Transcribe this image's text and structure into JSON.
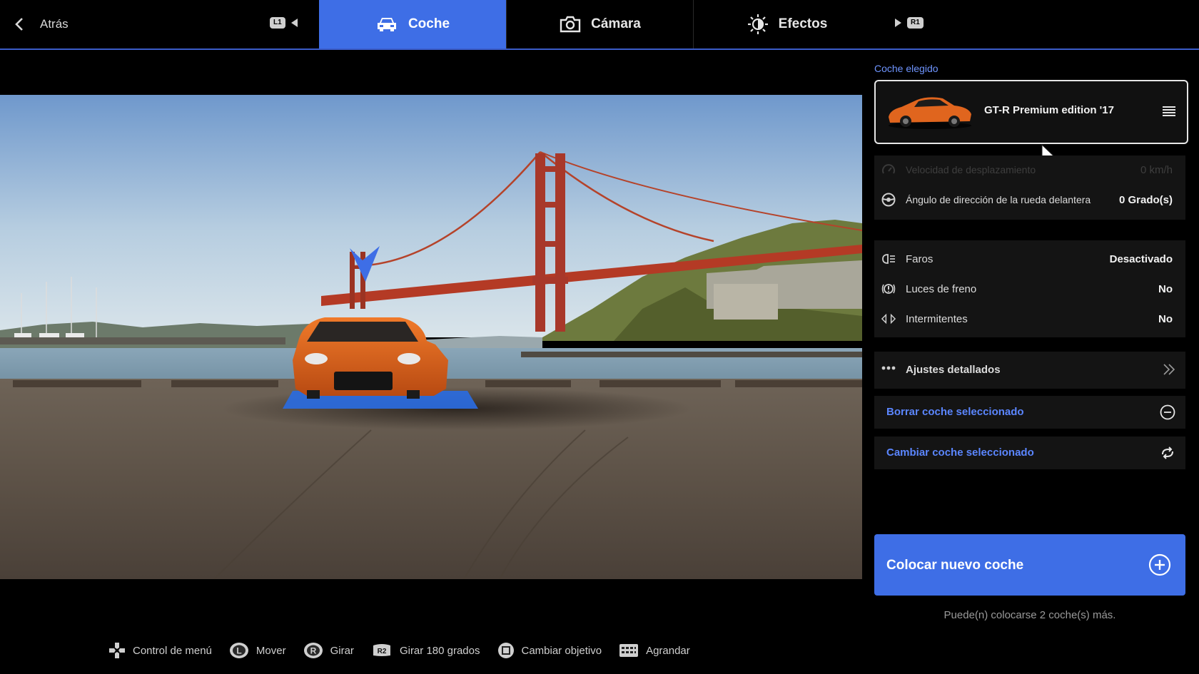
{
  "topbar": {
    "back_label": "Atrás",
    "left_shoulder": "L1",
    "right_shoulder": "R1",
    "tabs": [
      {
        "label": "Coche",
        "icon": "car-icon",
        "active": true
      },
      {
        "label": "Cámara",
        "icon": "camera-icon",
        "active": false
      },
      {
        "label": "Efectos",
        "icon": "brightness-icon",
        "active": false
      }
    ]
  },
  "panel": {
    "section_label": "Coche elegido",
    "selected_car": "GT-R Premium edition '17",
    "settings_group_1": [
      {
        "label": "Velocidad de desplazamiento",
        "value": "0 km/h",
        "icon": "speedometer-icon",
        "disabled": true
      },
      {
        "label": "Ángulo de dirección de la rueda delantera",
        "value": "0 Grado(s)",
        "icon": "steering-wheel-icon",
        "disabled": false
      }
    ],
    "settings_group_2": [
      {
        "label": "Faros",
        "value": "Desactivado",
        "icon": "headlight-icon"
      },
      {
        "label": "Luces de freno",
        "value": "No",
        "icon": "brake-light-icon"
      },
      {
        "label": "Intermitentes",
        "value": "No",
        "icon": "turn-signal-icon"
      }
    ],
    "detailed_settings": "Ajustes detallados",
    "delete_car": "Borrar coche seleccionado",
    "change_car": "Cambiar coche seleccionado",
    "place_new_car": "Colocar nuevo coche",
    "remaining_note": "Puede(n) colocarse 2 coche(s) más."
  },
  "hints": [
    {
      "button": "dpad-icon",
      "label": "Control de menú"
    },
    {
      "button": "L",
      "label": "Mover"
    },
    {
      "button": "R",
      "label": "Girar"
    },
    {
      "button": "R2",
      "label": "Girar 180 grados"
    },
    {
      "button": "square-icon",
      "label": "Cambiar objetivo"
    },
    {
      "button": "touchpad-icon",
      "label": "Agrandar"
    }
  ],
  "colors": {
    "accent": "#3e6ee6",
    "link": "#5b86ff",
    "panel_bg": "#141414",
    "car_body": "#e0651e"
  }
}
